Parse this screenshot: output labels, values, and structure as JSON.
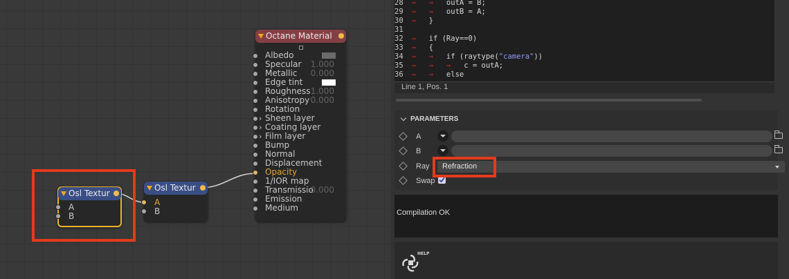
{
  "graph": {
    "octane_node": {
      "title": "Octane Material",
      "pins": [
        {
          "label": "Albedo",
          "swatch": "#6b6b6b"
        },
        {
          "label": "Specular",
          "value": "1.000"
        },
        {
          "label": "Metallic",
          "value": "0.000"
        },
        {
          "label": "Edge tint",
          "swatch": "#ffffff"
        },
        {
          "label": "Roughness",
          "value": "1.000"
        },
        {
          "label": "Anisotropy",
          "value": "0.000"
        },
        {
          "label": "Rotation"
        },
        {
          "label": "Sheen layer",
          "group": true
        },
        {
          "label": "Coating layer",
          "group": true
        },
        {
          "label": "Film layer",
          "group": true
        },
        {
          "label": "Bump"
        },
        {
          "label": "Normal"
        },
        {
          "label": "Displacement"
        },
        {
          "label": "Opacity",
          "active": true
        },
        {
          "label": "1/IOR map"
        },
        {
          "label": "Transmissio",
          "value": "0.000"
        },
        {
          "label": "Emission"
        },
        {
          "label": "Medium"
        }
      ]
    },
    "osl_node_selected": {
      "title": "Osl Textur",
      "inputs": [
        "A",
        "B"
      ]
    },
    "osl_node": {
      "title": "Osl Textur",
      "inputs": [
        "A",
        "B"
      ]
    }
  },
  "code_editor": {
    "lines": [
      {
        "n": "28",
        "indent": 2,
        "code": "outA = B;"
      },
      {
        "n": "29",
        "indent": 2,
        "code": "outB = A;"
      },
      {
        "n": "30",
        "indent": 1,
        "code": "}"
      },
      {
        "n": "31",
        "indent": 0,
        "code": ""
      },
      {
        "n": "32",
        "indent": 1,
        "code": "if (Ray==0)"
      },
      {
        "n": "33",
        "indent": 1,
        "code": "{"
      },
      {
        "n": "34",
        "indent": 2,
        "code": "if (raytype(",
        "str": "\"camera\"",
        "tail": "))"
      },
      {
        "n": "35",
        "indent": 3,
        "code": "c = outA;"
      },
      {
        "n": "36",
        "indent": 2,
        "code": "else"
      }
    ],
    "status": "Line 1, Pos. 1"
  },
  "parameters": {
    "header": "PARAMETERS",
    "rows": [
      {
        "label": "A"
      },
      {
        "label": "B"
      },
      {
        "label": "Ray",
        "value": "Refraction"
      },
      {
        "label": "Swap",
        "checked": true
      }
    ]
  },
  "compile_output": "Compilation OK",
  "help_label": "HELP",
  "colors": {
    "highlight_box": "#e33b1c",
    "selected_node_border": "#f0b429",
    "header_blue": "#3a4e86",
    "header_red": "#843f45"
  }
}
